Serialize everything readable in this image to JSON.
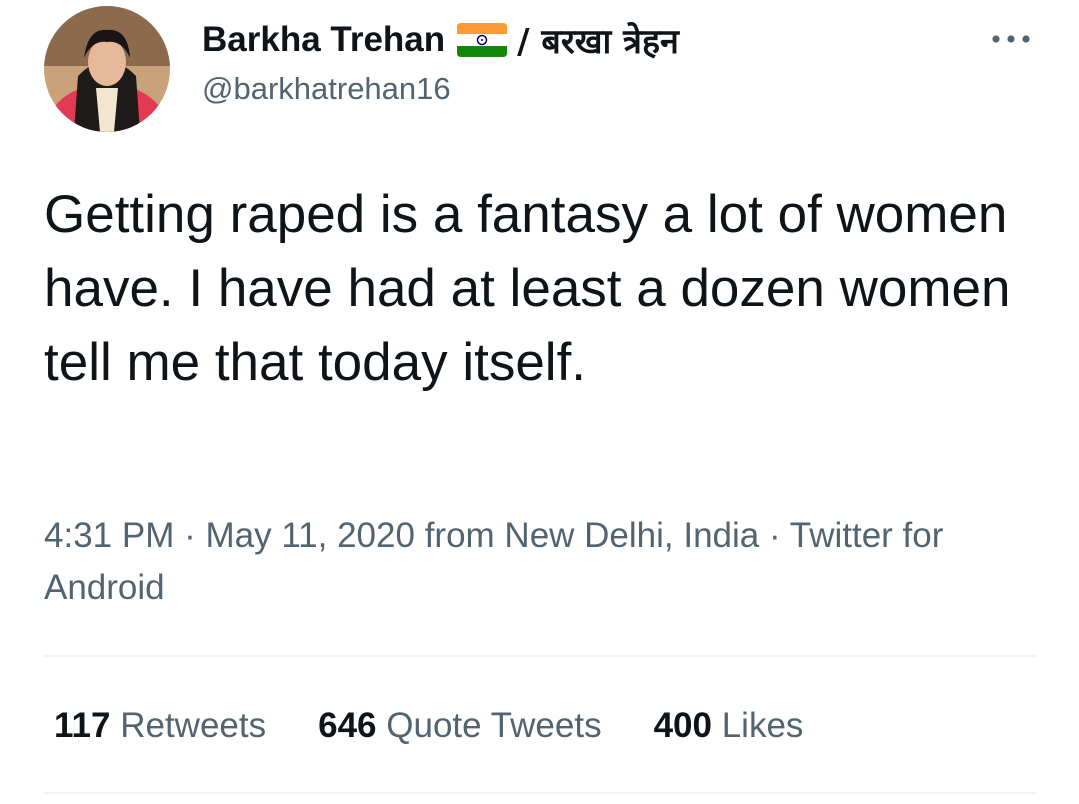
{
  "author": {
    "display_name": "Barkha Trehan",
    "flag": "india-flag",
    "native_name": "/ बरखा त्रेहन",
    "handle": "@barkhatrehan16"
  },
  "tweet": {
    "text": "Getting raped is a fantasy a lot of women have. I have had at least a dozen women tell me that today itself."
  },
  "meta": {
    "time": "4:31 PM",
    "sep1": " · ",
    "date": "May 11, 2020",
    "location": " from New Delhi, India",
    "sep2": " · ",
    "client": "Twitter for Android"
  },
  "stats": {
    "retweets_count": "117",
    "retweets_label": "Retweets",
    "quotes_count": "646",
    "quotes_label": "Quote Tweets",
    "likes_count": "400",
    "likes_label": "Likes"
  },
  "colors": {
    "text_primary": "#0f1419",
    "text_secondary": "#536471",
    "divider": "#eff3f4"
  }
}
